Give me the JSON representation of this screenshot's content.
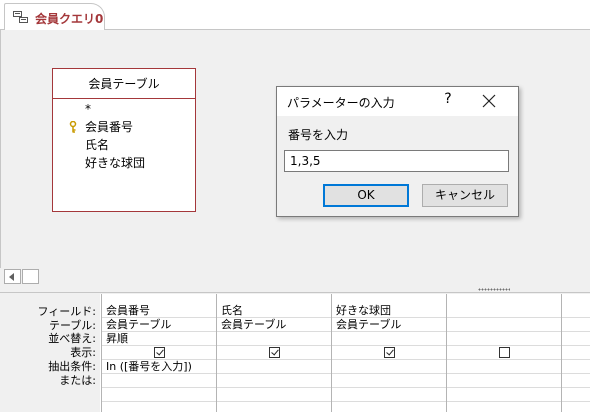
{
  "document_tab": {
    "label": "会員クエリ0",
    "icon": "query-icon"
  },
  "field_list": {
    "title": "会員テーブル",
    "items": [
      {
        "label": "*",
        "icon": ""
      },
      {
        "label": "会員番号",
        "icon": "primary-key-icon"
      },
      {
        "label": "氏名",
        "icon": ""
      },
      {
        "label": "好きな球団",
        "icon": ""
      }
    ]
  },
  "dialog": {
    "title": "パラメーターの入力",
    "help_label": "?",
    "prompt": "番号を入力",
    "input_value": "1,3,5",
    "ok_label": "OK",
    "cancel_label": "キャンセル"
  },
  "design_grid": {
    "row_labels": [
      "フィールド:",
      "テーブル:",
      "並べ替え:",
      "表示:",
      "抽出条件:",
      "または:"
    ],
    "columns": [
      {
        "field": "会員番号",
        "table": "会員テーブル",
        "sort": "昇順",
        "show": true,
        "criteria": "In ([番号を入力])",
        "or": ""
      },
      {
        "field": "氏名",
        "table": "会員テーブル",
        "sort": "",
        "show": true,
        "criteria": "",
        "or": ""
      },
      {
        "field": "好きな球団",
        "table": "会員テーブル",
        "sort": "",
        "show": true,
        "criteria": "",
        "or": ""
      },
      {
        "field": "",
        "table": "",
        "sort": "",
        "show": false,
        "criteria": "",
        "or": ""
      }
    ]
  },
  "colors": {
    "accent": "#a4373a",
    "focus_border": "#0078d7"
  }
}
